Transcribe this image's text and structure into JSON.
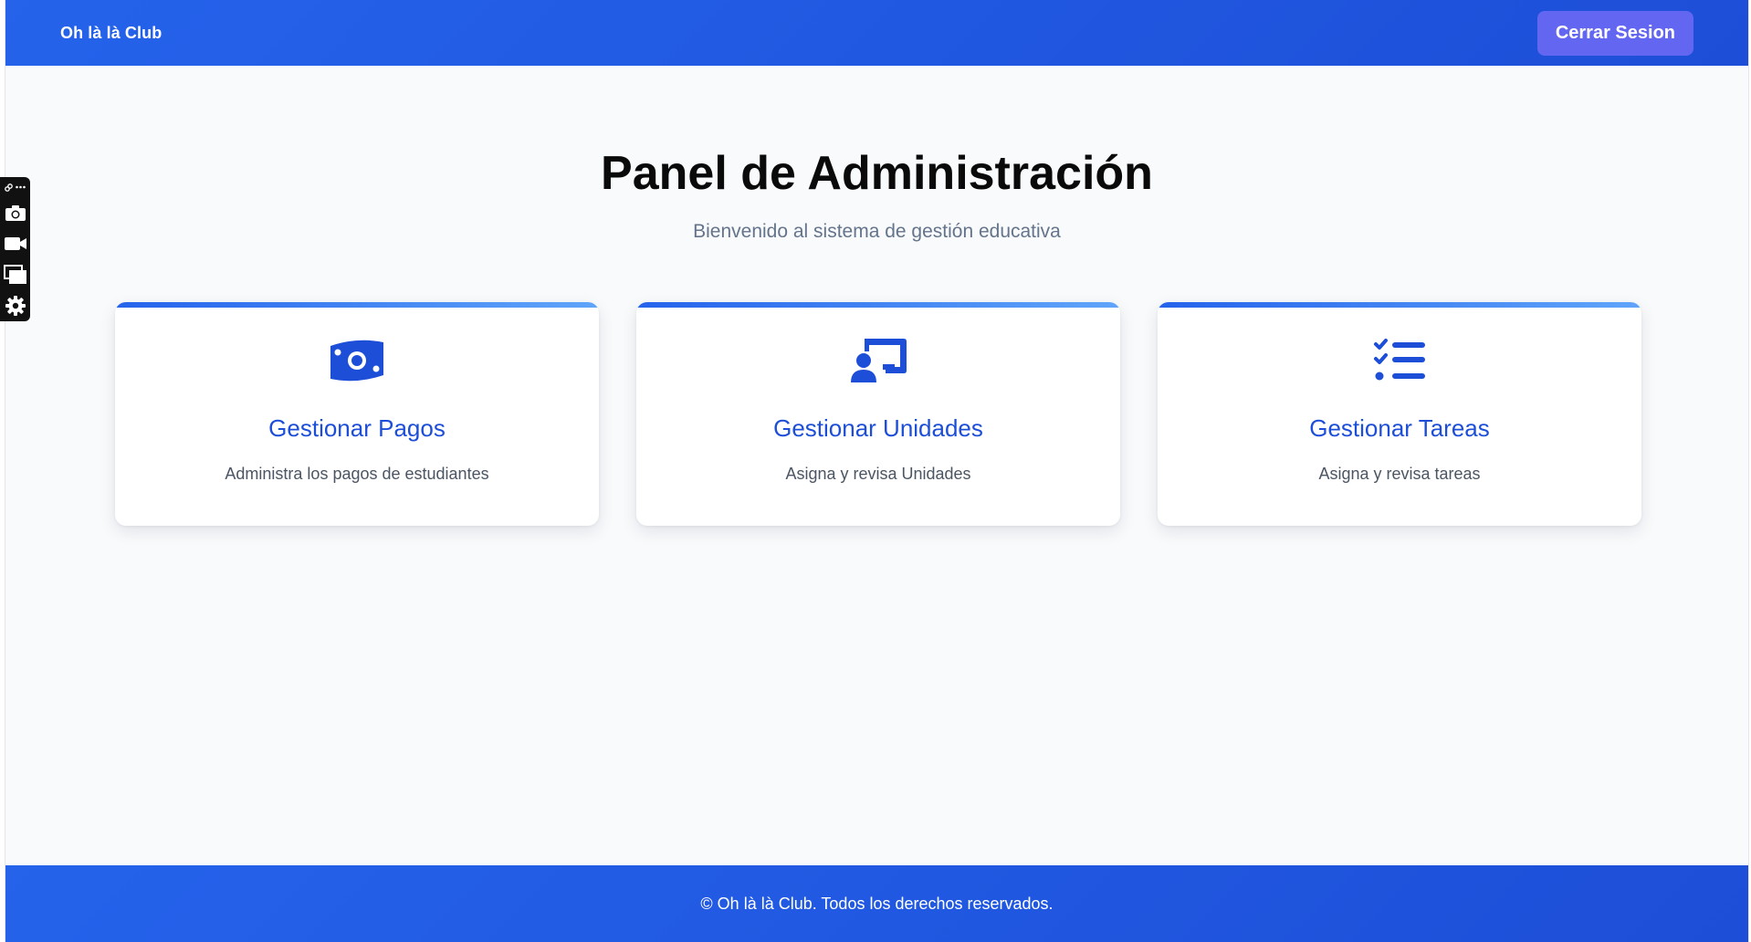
{
  "header": {
    "brand": "Oh là là Club",
    "logout_label": "Cerrar Sesion"
  },
  "main": {
    "title": "Panel de Administración",
    "subtitle": "Bienvenido al sistema de gestión educativa",
    "cards": [
      {
        "icon": "money-bill-icon",
        "title": "Gestionar Pagos",
        "description": "Administra los pagos de estudiantes"
      },
      {
        "icon": "chalkboard-user-icon",
        "title": "Gestionar Unidades",
        "description": "Asigna y revisa Unidades"
      },
      {
        "icon": "list-check-icon",
        "title": "Gestionar Tareas",
        "description": "Asigna y revisa tareas"
      }
    ]
  },
  "footer": {
    "text": "© Oh là là Club. Todos los derechos reservados."
  },
  "toolbar": {
    "items": [
      "camera-icon",
      "video-icon",
      "windows-icon",
      "settings-icon"
    ]
  },
  "colors": {
    "primary": "#2563eb",
    "primary_dark": "#1d4ed8",
    "accent": "#6366f1",
    "background": "#f8fafc"
  }
}
